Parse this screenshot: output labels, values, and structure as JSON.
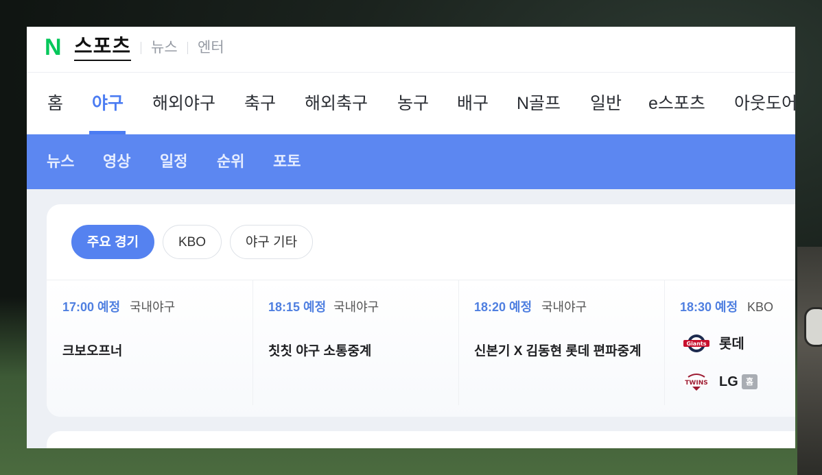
{
  "header": {
    "logo_letter": "N",
    "logo_text": "스포츠",
    "links": [
      "뉴스",
      "엔터"
    ]
  },
  "main_nav": {
    "items": [
      "홈",
      "야구",
      "해외야구",
      "축구",
      "해외축구",
      "농구",
      "배구",
      "N골프",
      "일반",
      "e스포츠",
      "아웃도어"
    ],
    "active": "야구"
  },
  "sub_nav": {
    "items": [
      "뉴스",
      "영상",
      "일정",
      "순위",
      "포토"
    ]
  },
  "filters": {
    "chips": [
      "주요 경기",
      "KBO",
      "야구 기타"
    ],
    "active": "주요 경기"
  },
  "games": [
    {
      "time": "17:00 예정",
      "category": "국내야구",
      "title": "크보오프너"
    },
    {
      "time": "18:15 예정",
      "category": "국내야구",
      "title": "칫칫 야구 소통중계"
    },
    {
      "time": "18:20 예정",
      "category": "국내야구",
      "title": "신본기 X 김동현 롯데 편파중계"
    },
    {
      "time": "18:30 예정",
      "category": "KBO",
      "away_team": "롯데",
      "away_logo_text": "Giants",
      "home_team": "LG",
      "home_logo_text": "TWINS",
      "home_badge": "홈"
    }
  ],
  "colors": {
    "accent": "#4b7cf2",
    "subnav_bg": "#5c87f1",
    "naver_green": "#03c75a"
  }
}
